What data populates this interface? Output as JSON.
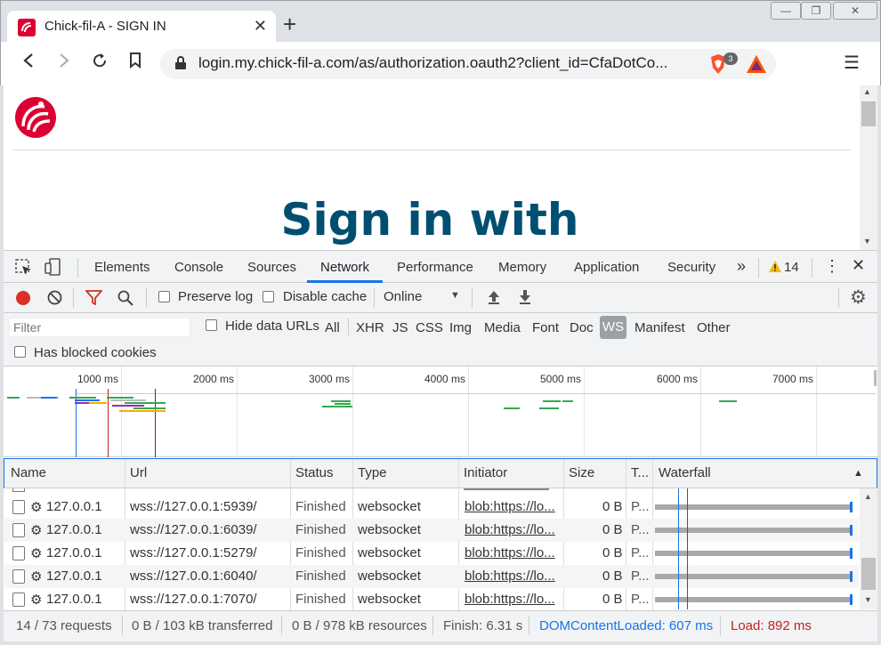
{
  "browser": {
    "tab_title": "Chick-fil-A - SIGN IN",
    "tab_close": "✕",
    "new_tab": "+",
    "url": "login.my.chick-fil-a.com/as/authorization.oauth2?client_id=CfaDotCo...",
    "brave_count": "3",
    "window": {
      "minimize": "—",
      "maximize": "❐",
      "close": "✕"
    },
    "menu_glyph": "☰"
  },
  "page": {
    "heading": "Sign in with",
    "brand_color": "#004f71",
    "logo_color": "#dd0033"
  },
  "devtools": {
    "tabs": [
      "Elements",
      "Console",
      "Sources",
      "Network",
      "Performance",
      "Memory",
      "Application",
      "Security"
    ],
    "active_tab": "Network",
    "more": "»",
    "warning_count": "14",
    "toolbar": {
      "preserve_log": "Preserve log",
      "disable_cache": "Disable cache",
      "throttling": "Online"
    },
    "filter": {
      "placeholder": "Filter",
      "hide_data_urls": "Hide data URLs",
      "types": [
        "All",
        "XHR",
        "JS",
        "CSS",
        "Img",
        "Media",
        "Font",
        "Doc",
        "WS",
        "Manifest",
        "Other"
      ],
      "active_type": "WS",
      "has_blocked_cookies": "Has blocked cookies"
    },
    "timeline_ticks": [
      "1000 ms",
      "2000 ms",
      "3000 ms",
      "4000 ms",
      "5000 ms",
      "6000 ms",
      "7000 ms"
    ],
    "table": {
      "columns": [
        "Name",
        "Url",
        "Status",
        "Type",
        "Initiator",
        "Size",
        "T...",
        "Waterfall"
      ],
      "sort_glyph": "▲",
      "rows": [
        {
          "name": "127.0.0.1",
          "url": "wss://127.0.0.1:5939/",
          "status": "Finished",
          "type": "websocket",
          "initiator": "blob:https://lo...",
          "size": "0 B",
          "time": "P..."
        },
        {
          "name": "127.0.0.1",
          "url": "wss://127.0.0.1:6039/",
          "status": "Finished",
          "type": "websocket",
          "initiator": "blob:https://lo...",
          "size": "0 B",
          "time": "P..."
        },
        {
          "name": "127.0.0.1",
          "url": "wss://127.0.0.1:5279/",
          "status": "Finished",
          "type": "websocket",
          "initiator": "blob:https://lo...",
          "size": "0 B",
          "time": "P..."
        },
        {
          "name": "127.0.0.1",
          "url": "wss://127.0.0.1:6040/",
          "status": "Finished",
          "type": "websocket",
          "initiator": "blob:https://lo...",
          "size": "0 B",
          "time": "P..."
        },
        {
          "name": "127.0.0.1",
          "url": "wss://127.0.0.1:7070/",
          "status": "Finished",
          "type": "websocket",
          "initiator": "blob:https://lo...",
          "size": "0 B",
          "time": "P..."
        }
      ]
    },
    "status": {
      "requests": "14 / 73 requests",
      "transferred": "0 B / 103 kB transferred",
      "resources": "0 B / 978 kB resources",
      "finish": "Finish: 6.31 s",
      "dcl": "DOMContentLoaded: 607 ms",
      "load": "Load: 892 ms"
    },
    "colors": {
      "accent": "#1a73e8",
      "record": "#d93025",
      "dcl": "#1a73e8",
      "load": "#c5221f"
    }
  }
}
